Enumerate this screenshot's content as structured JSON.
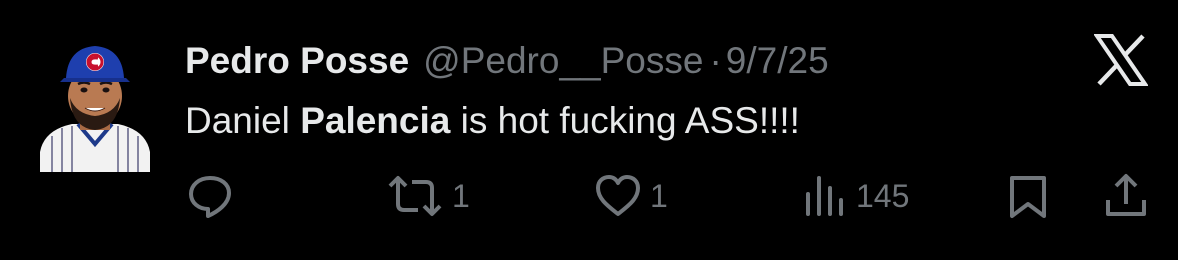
{
  "tweet": {
    "author_name": "Pedro Posse",
    "handle": "@Pedro__Posse",
    "separator": "·",
    "date": "9/7/25",
    "text_before": "Daniel ",
    "text_bold": "Palencia",
    "text_after": " is hot fucking ASS!!!!",
    "avatar_icon": "baseball-player-avatar-icon",
    "brand_icon": "x-logo-icon"
  },
  "actions": {
    "reply": {
      "icon": "reply-icon",
      "count": ""
    },
    "retweet": {
      "icon": "retweet-icon",
      "count": "1"
    },
    "like": {
      "icon": "heart-icon",
      "count": "1"
    },
    "views": {
      "icon": "views-icon",
      "count": "145"
    },
    "bookmark": {
      "icon": "bookmark-icon",
      "count": ""
    },
    "share": {
      "icon": "share-icon",
      "count": ""
    }
  },
  "colors": {
    "background": "#000000",
    "primary_text": "#e7e9ea",
    "secondary_text": "#71767b"
  }
}
